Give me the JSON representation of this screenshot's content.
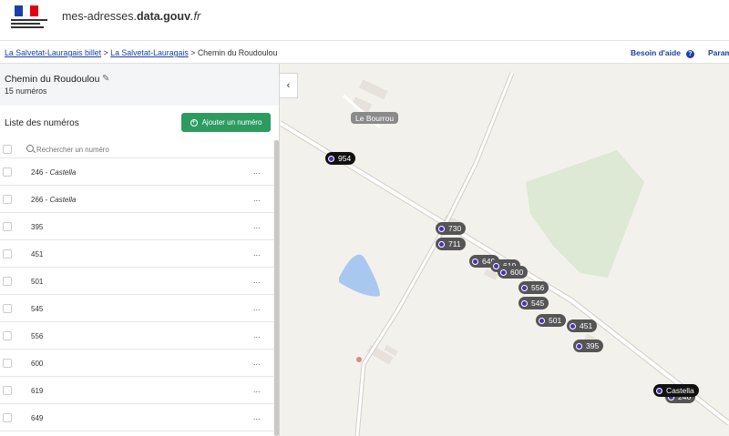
{
  "header": {
    "site_name_prefix": "mes-adresses.",
    "site_name_bold": "data.gouv",
    "site_name_suffix": ".fr"
  },
  "breadcrumb": {
    "items": [
      "La Salvetat-Lauragais billet",
      "La Salvetat-Lauragais",
      "Chemin du Roudoulou"
    ],
    "separator": ">"
  },
  "topnav": {
    "help_label": "Besoin d'aide",
    "help_icon": "?",
    "params_label": "Param"
  },
  "voie": {
    "name": "Chemin du Roudoulou",
    "count_label": "15 numéros"
  },
  "list": {
    "title": "Liste des numéros",
    "add_button": "Ajouter un numéro",
    "search_placeholder": "Rechercher un numéro",
    "rows": [
      {
        "number": "246",
        "suffix": "Castella"
      },
      {
        "number": "266",
        "suffix": "Castella"
      },
      {
        "number": "395",
        "suffix": ""
      },
      {
        "number": "451",
        "suffix": ""
      },
      {
        "number": "501",
        "suffix": ""
      },
      {
        "number": "545",
        "suffix": ""
      },
      {
        "number": "556",
        "suffix": ""
      },
      {
        "number": "600",
        "suffix": ""
      },
      {
        "number": "619",
        "suffix": ""
      },
      {
        "number": "649",
        "suffix": ""
      }
    ],
    "row_menu": "..."
  },
  "map": {
    "collapse_icon": "‹",
    "place_label": "Le Bourrou",
    "castella_label": "Castella",
    "markers": [
      "954",
      "730",
      "711",
      "649",
      "619",
      "600",
      "556",
      "545",
      "501",
      "451",
      "395",
      "246"
    ]
  },
  "colors": {
    "primary_link": "#1a3fa8",
    "add_button": "#2d9b5f",
    "marker": "#555555",
    "marker_dot": "#4a2fbf",
    "map_bg": "#f3f1ec",
    "water": "#a9c8f0",
    "park": "#dde8d5"
  }
}
